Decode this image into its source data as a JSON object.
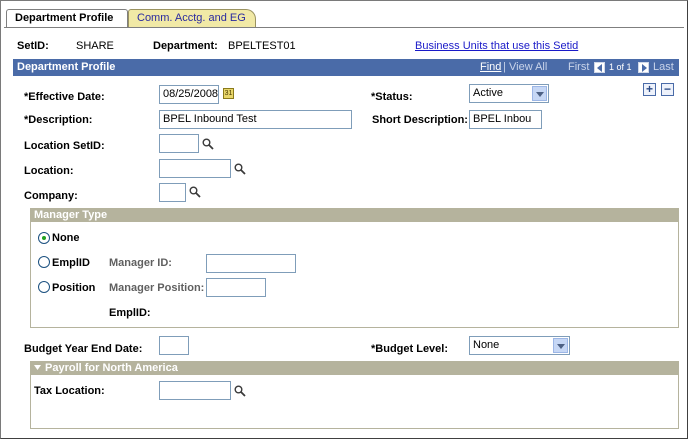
{
  "tabs": [
    {
      "label": "Department Profile",
      "active": true
    },
    {
      "label": "Comm. Acctg. and EG",
      "active": false
    }
  ],
  "top": {
    "setid_label": "SetID:",
    "setid_value": "SHARE",
    "department_label": "Department:",
    "department_value": "BPELTEST01",
    "business_units_link": "Business Units that use this Setid"
  },
  "section": {
    "title": "Department Profile",
    "find": "Find",
    "view_all": "View All",
    "separator": "|",
    "first": "First",
    "pager": "1 of 1",
    "last": "Last",
    "add_symbol": "+",
    "remove_symbol": "−"
  },
  "fields": {
    "effective_date_label": "*Effective Date:",
    "effective_date_value": "08/25/2008",
    "status_label": "*Status:",
    "status_value": "Active",
    "description_label": "*Description:",
    "description_value": "BPEL Inbound Test",
    "short_description_label": "Short Description:",
    "short_description_value": "BPEL Inbou",
    "location_setid_label": "Location SetID:",
    "location_setid_value": "",
    "location_label": "Location:",
    "location_value": "",
    "company_label": "Company:",
    "company_value": ""
  },
  "manager_type": {
    "title": "Manager Type",
    "selected": "None",
    "options": [
      "None",
      "EmplID",
      "Position"
    ],
    "manager_id_label": "Manager ID:",
    "manager_id_value": "",
    "manager_position_label": "Manager Position:",
    "manager_position_value": "",
    "emplid_label": "EmplID:"
  },
  "budget": {
    "year_end_label": "Budget Year End Date:",
    "year_end_value": "",
    "level_label": "*Budget Level:",
    "level_value": "None"
  },
  "payroll": {
    "title": "Payroll for North America",
    "tax_location_label": "Tax Location:",
    "tax_location_value": ""
  },
  "colors": {
    "header_bar": "#4a6ba8",
    "group_header": "#b5b39d",
    "inactive_tab": "#f1e9a6",
    "link": "#1a1ac8"
  },
  "icons": [
    "lookup-icon",
    "calendar-icon",
    "add-row-icon",
    "delete-row-icon",
    "nav-left-icon",
    "nav-right-icon",
    "collapse-triangle-icon"
  ]
}
